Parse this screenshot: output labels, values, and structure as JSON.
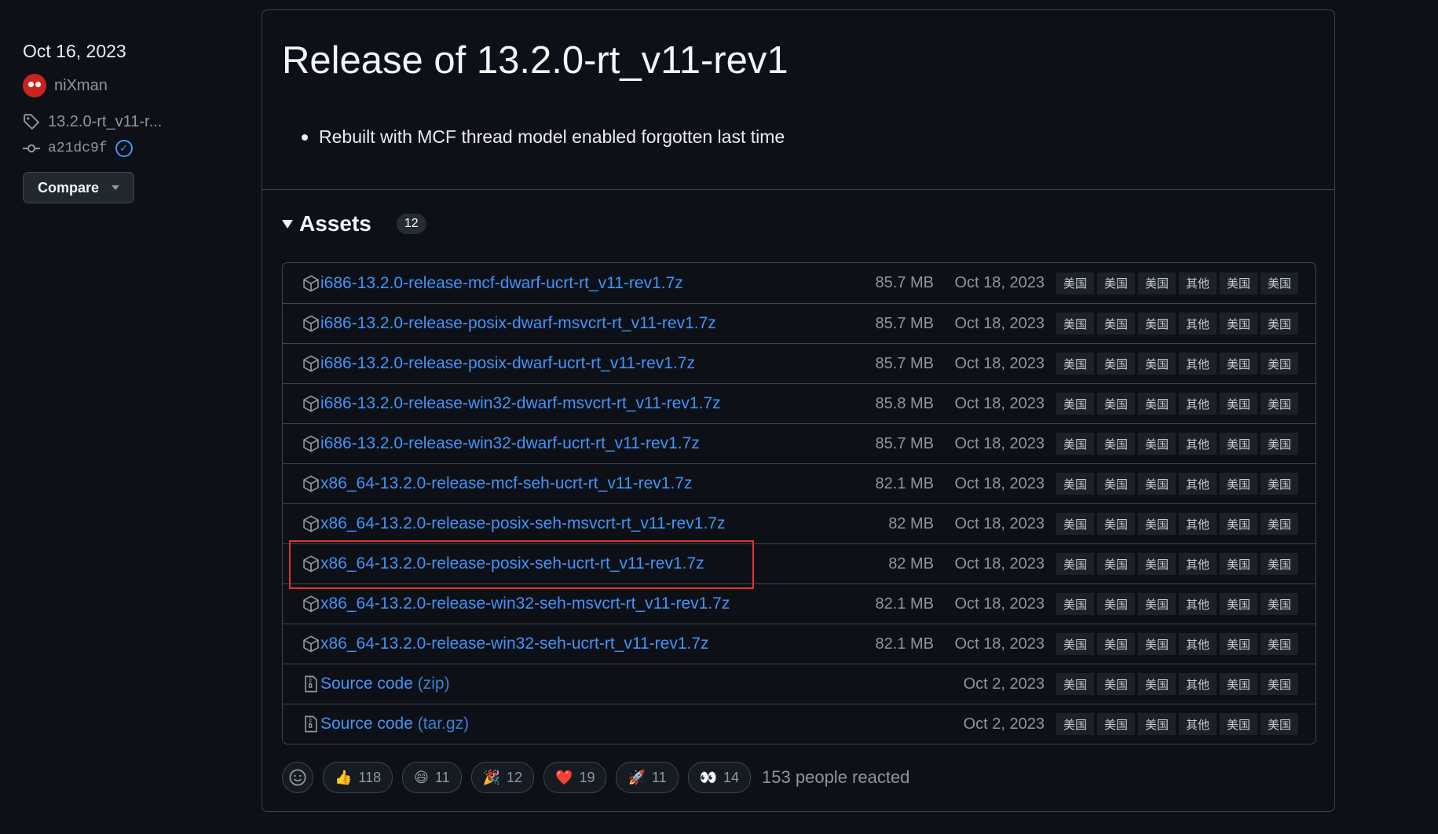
{
  "sidebar": {
    "date": "Oct 16, 2023",
    "author": "niXman",
    "tag": "13.2.0-rt_v11-r...",
    "commit": "a21dc9f",
    "compare_label": "Compare"
  },
  "release": {
    "title": "Release of 13.2.0-rt_v11-rev1",
    "notes": [
      "Rebuilt with MCF thread model enabled forgotten last time"
    ],
    "assets_label": "Assets",
    "assets_count": "12"
  },
  "assets": [
    {
      "name": "i686-13.2.0-release-mcf-dwarf-ucrt-rt_v11-rev1.7z",
      "size": "85.7 MB",
      "date": "Oct 18, 2023",
      "icon": "package-icon"
    },
    {
      "name": "i686-13.2.0-release-posix-dwarf-msvcrt-rt_v11-rev1.7z",
      "size": "85.7 MB",
      "date": "Oct 18, 2023",
      "icon": "package-icon"
    },
    {
      "name": "i686-13.2.0-release-posix-dwarf-ucrt-rt_v11-rev1.7z",
      "size": "85.7 MB",
      "date": "Oct 18, 2023",
      "icon": "package-icon"
    },
    {
      "name": "i686-13.2.0-release-win32-dwarf-msvcrt-rt_v11-rev1.7z",
      "size": "85.8 MB",
      "date": "Oct 18, 2023",
      "icon": "package-icon"
    },
    {
      "name": "i686-13.2.0-release-win32-dwarf-ucrt-rt_v11-rev1.7z",
      "size": "85.7 MB",
      "date": "Oct 18, 2023",
      "icon": "package-icon"
    },
    {
      "name": "x86_64-13.2.0-release-mcf-seh-ucrt-rt_v11-rev1.7z",
      "size": "82.1 MB",
      "date": "Oct 18, 2023",
      "icon": "package-icon"
    },
    {
      "name": "x86_64-13.2.0-release-posix-seh-msvcrt-rt_v11-rev1.7z",
      "size": "82 MB",
      "date": "Oct 18, 2023",
      "icon": "package-icon"
    },
    {
      "name": "x86_64-13.2.0-release-posix-seh-ucrt-rt_v11-rev1.7z",
      "size": "82 MB",
      "date": "Oct 18, 2023",
      "icon": "package-icon"
    },
    {
      "name": "x86_64-13.2.0-release-win32-seh-msvcrt-rt_v11-rev1.7z",
      "size": "82.1 MB",
      "date": "Oct 18, 2023",
      "icon": "package-icon"
    },
    {
      "name": "x86_64-13.2.0-release-win32-seh-ucrt-rt_v11-rev1.7z",
      "size": "82.1 MB",
      "date": "Oct 18, 2023",
      "icon": "package-icon"
    },
    {
      "name": "Source code",
      "suffix": " (zip)",
      "size": "",
      "date": "Oct 2, 2023",
      "icon": "file-zip-icon"
    },
    {
      "name": "Source code",
      "suffix": " (tar.gz)",
      "size": "",
      "date": "Oct 2, 2023",
      "icon": "file-zip-icon"
    }
  ],
  "mirrors": [
    "美国",
    "美国",
    "美国",
    "其他",
    "美国",
    "美国"
  ],
  "highlighted_asset_index": 7,
  "reactions": [
    {
      "emoji": "👍",
      "count": "118",
      "icon": "thumbs-up-icon"
    },
    {
      "emoji": "😄",
      "count": "11",
      "icon": "smile-icon"
    },
    {
      "emoji": "🎉",
      "count": "12",
      "icon": "tada-icon"
    },
    {
      "emoji": "❤️",
      "count": "19",
      "icon": "heart-icon"
    },
    {
      "emoji": "🚀",
      "count": "11",
      "icon": "rocket-icon"
    },
    {
      "emoji": "👀",
      "count": "14",
      "icon": "eyes-icon"
    }
  ],
  "reacted_text": "153 people reacted",
  "colors": {
    "link": "#4493f8",
    "bg": "#0d1117",
    "border": "#3d444d",
    "highlight": "#e5322c"
  }
}
